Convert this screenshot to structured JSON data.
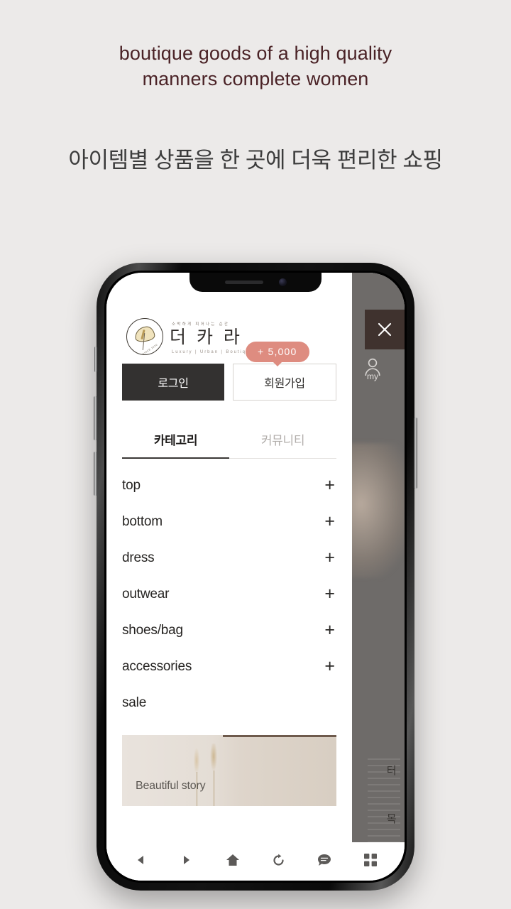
{
  "promo": {
    "english_line1": "boutique goods of a high quality",
    "english_line2": "manners complete women",
    "korean": "아이템별 상품을 한 곳에 더욱 편리한 쇼핑",
    "english_color": "#4a2226",
    "korean_color": "#3c3c3c",
    "background_color": "#eceae9"
  },
  "app": {
    "brand": {
      "tagline_top": "소박하게 피어나는 순간",
      "name": "더 카 라",
      "tagline_bottom": "Luxury | Urban | Boutique",
      "mark_since": "SINCE 2020"
    },
    "auth": {
      "login_label": "로그인",
      "signup_label": "회원가입",
      "reward_badge": "+ 5,000",
      "badge_color": "#de8c80",
      "login_bg": "#333130"
    },
    "tabs": [
      {
        "label": "카테고리",
        "active": true
      },
      {
        "label": "커뮤니티",
        "active": false
      }
    ],
    "categories": [
      {
        "label": "top",
        "expandable": "+"
      },
      {
        "label": "bottom",
        "expandable": "+"
      },
      {
        "label": "dress",
        "expandable": "+"
      },
      {
        "label": "outwear",
        "expandable": "+"
      },
      {
        "label": "shoes/bag",
        "expandable": "+"
      },
      {
        "label": "accessories",
        "expandable": "+"
      },
      {
        "label": "sale",
        "expandable": ""
      }
    ],
    "story_banner": {
      "label": "Beautiful story"
    },
    "overlay": {
      "close_icon": "close-icon",
      "my_icon_label": "my",
      "side_text_1": "터",
      "side_text_2": "목",
      "dim_color": "#6e6b69",
      "close_bg": "#3f322e"
    },
    "browser_nav": [
      {
        "name": "back",
        "icon": "back-triangle-icon"
      },
      {
        "name": "forward",
        "icon": "forward-triangle-icon"
      },
      {
        "name": "home",
        "icon": "home-icon"
      },
      {
        "name": "refresh",
        "icon": "refresh-icon"
      },
      {
        "name": "chat",
        "icon": "chat-bubble-icon"
      },
      {
        "name": "tabs",
        "icon": "grid-icon"
      }
    ]
  }
}
